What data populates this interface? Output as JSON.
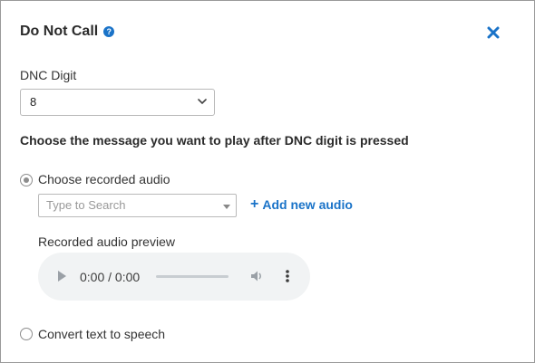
{
  "dialog": {
    "title": "Do Not Call",
    "help_icon_glyph": "?",
    "help_icon": "question-circle-icon",
    "close_icon": "close-icon"
  },
  "dnc": {
    "label": "DNC Digit",
    "selected_value": "8"
  },
  "message_heading": "Choose the message you want to play after DNC digit is pressed",
  "options": {
    "recorded": {
      "label": "Choose recorded audio",
      "checked": true
    },
    "tts": {
      "label": "Convert text to speech",
      "checked": false
    }
  },
  "search": {
    "placeholder": "Type to Search"
  },
  "add_audio": {
    "plus": "+",
    "label": "Add new audio"
  },
  "preview": {
    "label": "Recorded audio preview",
    "time": "0:00 / 0:00"
  },
  "colors": {
    "accent": "#1a73c8",
    "border": "#b9b9b9",
    "player_bg": "#f1f3f4"
  }
}
